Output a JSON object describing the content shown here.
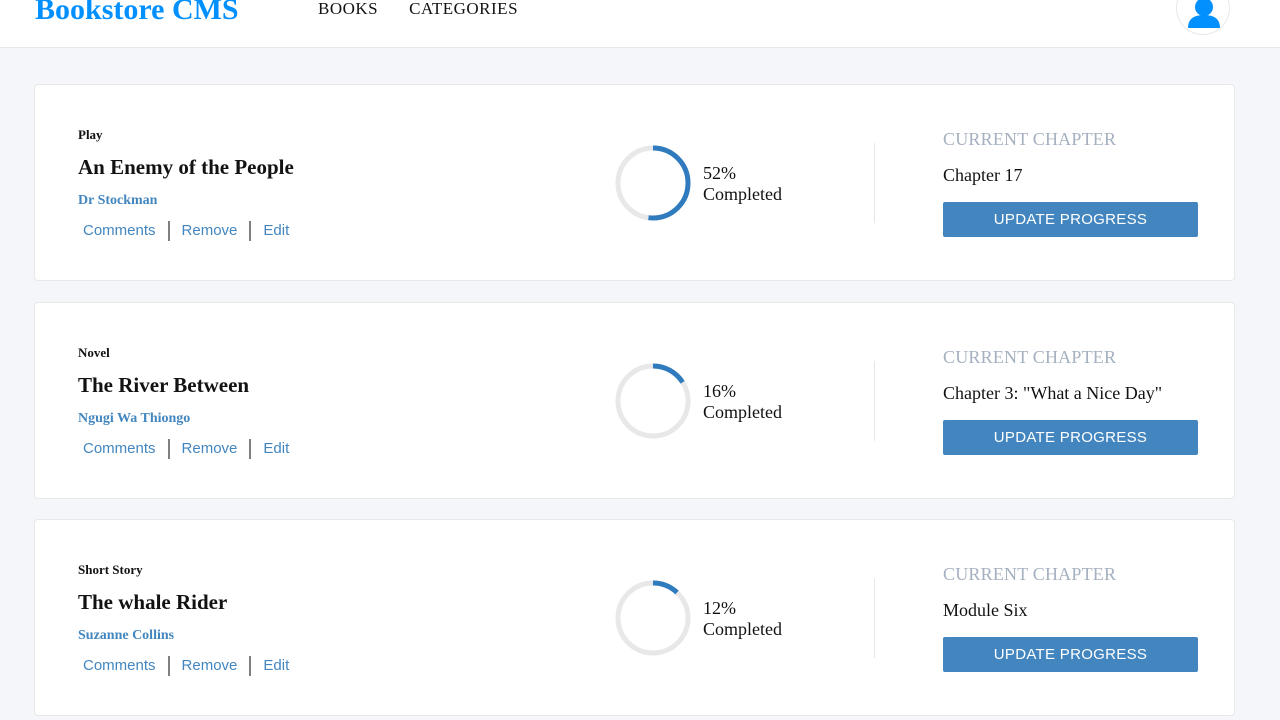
{
  "header": {
    "logo": "Bookstore CMS",
    "nav": [
      "BOOKS",
      "CATEGORIES"
    ]
  },
  "colors": {
    "accent": "#0290ff",
    "primary": "#4386bf",
    "muted": "#a5b0c0",
    "track": "#e8e8e8"
  },
  "books": [
    {
      "genre": "Play",
      "title": "An Enemy of the People",
      "author": "Dr Stockman",
      "actions": [
        "Comments",
        "Remove",
        "Edit"
      ],
      "percent_label": "52%",
      "completed_label": "Completed",
      "progress": 0.52,
      "chapter_heading": "CURRENT CHAPTER",
      "chapter": "Chapter 17",
      "button": "UPDATE PROGRESS"
    },
    {
      "genre": "Novel",
      "title": "The River Between",
      "author": "Ngugi Wa Thiongo",
      "actions": [
        "Comments",
        "Remove",
        "Edit"
      ],
      "percent_label": "16%",
      "completed_label": "Completed",
      "progress": 0.16,
      "chapter_heading": "CURRENT CHAPTER",
      "chapter": "Chapter 3: \"What a Nice Day\"",
      "button": "UPDATE PROGRESS"
    },
    {
      "genre": "Short Story",
      "title": "The whale Rider",
      "author": "Suzanne Collins",
      "actions": [
        "Comments",
        "Remove",
        "Edit"
      ],
      "percent_label": "12%",
      "completed_label": "Completed",
      "progress": 0.12,
      "chapter_heading": "CURRENT CHAPTER",
      "chapter": "Module Six",
      "button": "UPDATE PROGRESS"
    }
  ]
}
